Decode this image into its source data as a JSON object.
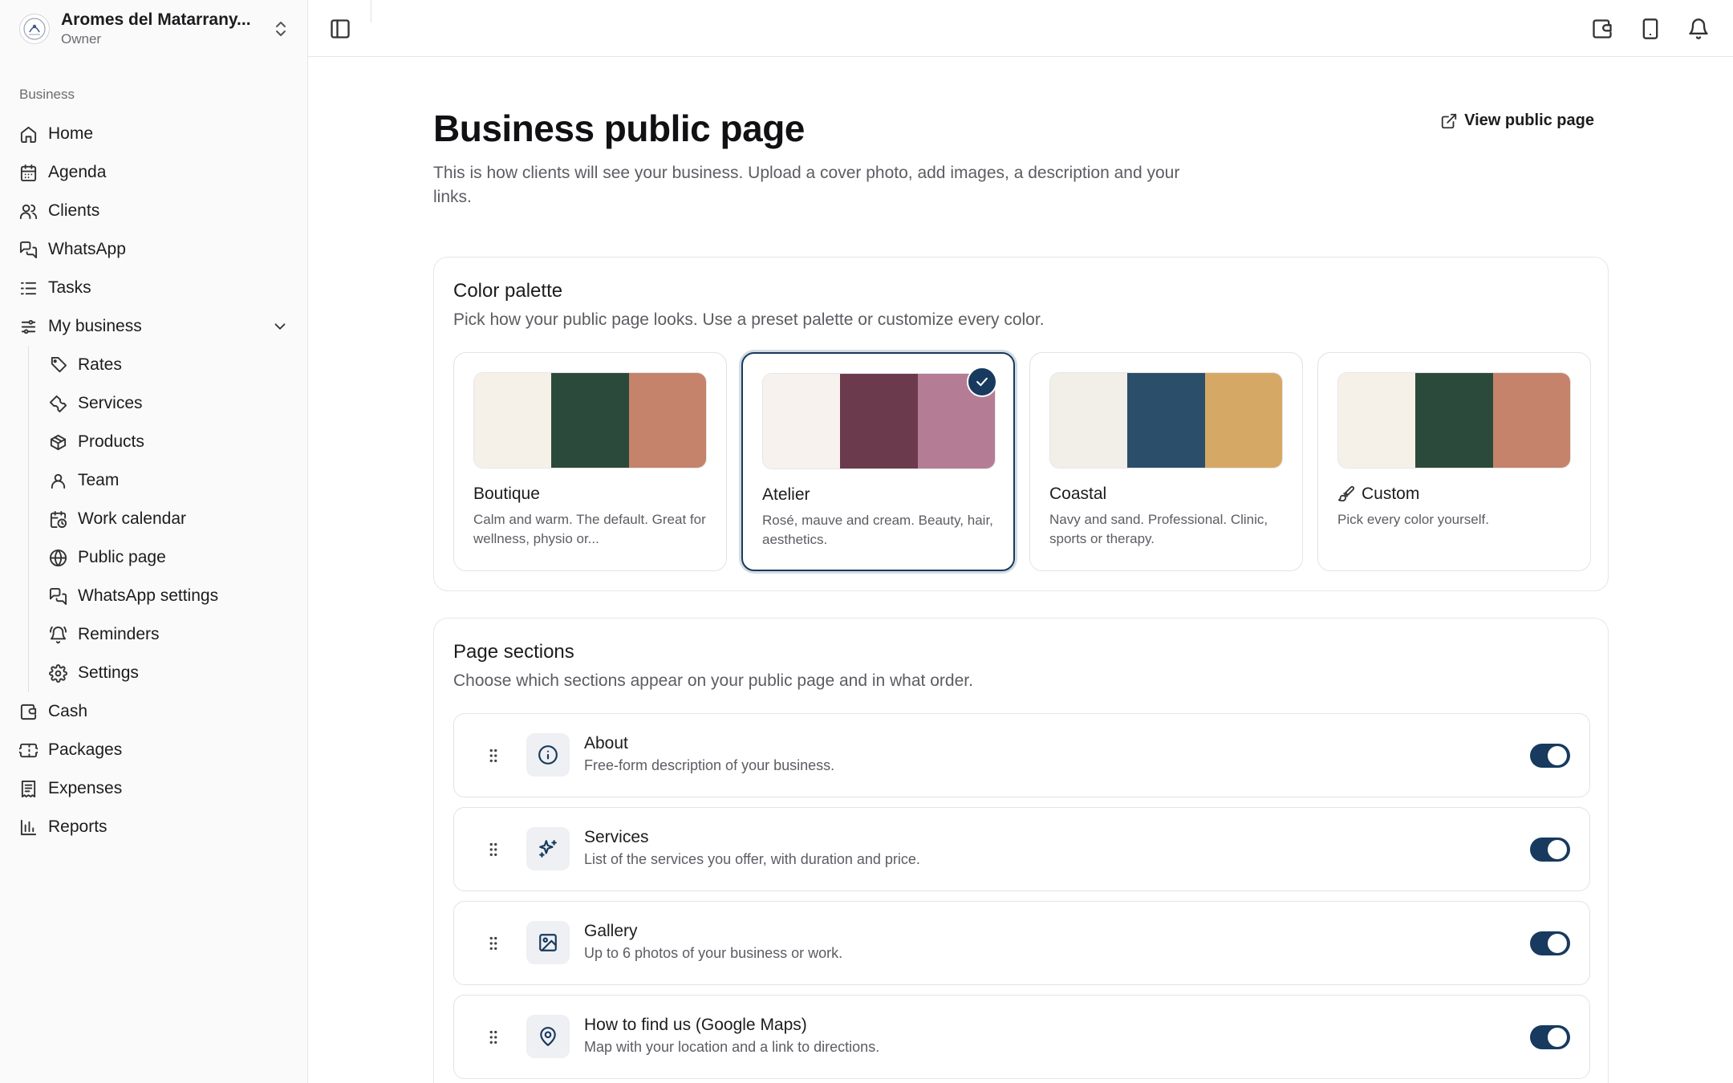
{
  "app": {
    "business_name": "Aromes del Matarrany...",
    "role": "Owner"
  },
  "sidebar": {
    "section_label": "Business",
    "items": [
      {
        "label": "Home",
        "icon": "home-icon"
      },
      {
        "label": "Agenda",
        "icon": "calendar-icon"
      },
      {
        "label": "Clients",
        "icon": "users-icon"
      },
      {
        "label": "WhatsApp",
        "icon": "chat-icon"
      },
      {
        "label": "Tasks",
        "icon": "list-checks-icon"
      },
      {
        "label": "My business",
        "icon": "sliders-icon",
        "expanded": true
      }
    ],
    "sub_items": [
      {
        "label": "Rates",
        "icon": "tag-icon"
      },
      {
        "label": "Services",
        "icon": "wrench-icon"
      },
      {
        "label": "Products",
        "icon": "package-icon"
      },
      {
        "label": "Team",
        "icon": "user-icon"
      },
      {
        "label": "Work calendar",
        "icon": "calendar-clock-icon"
      },
      {
        "label": "Public page",
        "icon": "globe-icon"
      },
      {
        "label": "WhatsApp settings",
        "icon": "chat-icon"
      },
      {
        "label": "Reminders",
        "icon": "bell-ring-icon"
      },
      {
        "label": "Settings",
        "icon": "gear-icon"
      }
    ],
    "bottom_items": [
      {
        "label": "Cash",
        "icon": "wallet-icon"
      },
      {
        "label": "Packages",
        "icon": "ticket-icon"
      },
      {
        "label": "Expenses",
        "icon": "receipt-icon"
      },
      {
        "label": "Reports",
        "icon": "bar-chart-icon"
      }
    ]
  },
  "page": {
    "title": "Business public page",
    "subtitle": "This is how clients will see your business. Upload a cover photo, add images, a description and your links.",
    "view_link": "View public page"
  },
  "palette_card": {
    "title": "Color palette",
    "description": "Pick how your public page looks. Use a preset palette or customize every color.",
    "options": [
      {
        "name": "Boutique",
        "description": "Calm and warm. The default. Great for wellness, physio or...",
        "colors": [
          "#f6f1e8",
          "#2b4a3c",
          "#c4836a"
        ],
        "selected": false
      },
      {
        "name": "Atelier",
        "description": "Rosé, mauve and cream. Beauty, hair, aesthetics.",
        "colors": [
          "#f7f2ee",
          "#6b3a4d",
          "#b57d95"
        ],
        "selected": true
      },
      {
        "name": "Coastal",
        "description": "Navy and sand. Professional. Clinic, sports or therapy.",
        "colors": [
          "#f1efe8",
          "#2b4e6b",
          "#d6a865"
        ],
        "selected": false
      },
      {
        "name": "Custom",
        "description": "Pick every color yourself.",
        "colors": [
          "#f6f1e8",
          "#2b4a3c",
          "#c4836a"
        ],
        "selected": false
      }
    ]
  },
  "sections_card": {
    "title": "Page sections",
    "description": "Choose which sections appear on your public page and in what order.",
    "rows": [
      {
        "title": "About",
        "description": "Free-form description of your business.",
        "icon": "info-icon",
        "enabled": true
      },
      {
        "title": "Services",
        "description": "List of the services you offer, with duration and price.",
        "icon": "sparkles-icon",
        "enabled": true
      },
      {
        "title": "Gallery",
        "description": "Up to 6 photos of your business or work.",
        "icon": "image-icon",
        "enabled": true
      },
      {
        "title": "How to find us (Google Maps)",
        "description": "Map with your location and a link to directions.",
        "icon": "map-pin-icon",
        "enabled": true
      }
    ]
  },
  "colors": {
    "accent": "#173a5e",
    "muted_text": "#5c5c63",
    "border": "#e6e6e8"
  }
}
